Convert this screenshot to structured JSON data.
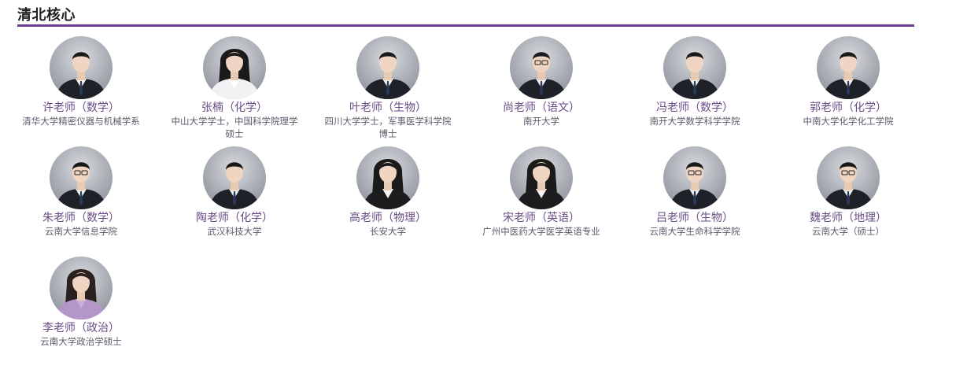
{
  "section": {
    "title": "清北核心"
  },
  "teachers": [
    {
      "name": "许老师（数学）",
      "school": "清华大学精密仪器与机械学系",
      "avatar": "male-suit-teacher"
    },
    {
      "name": "张楠（化学）",
      "school": "中山大学学士，中国科学院理学硕士",
      "avatar": "female-white-blouse-teacher"
    },
    {
      "name": "叶老师（生物）",
      "school": "四川大学学士，军事医学科学院博士",
      "avatar": "male-dark-suit-teacher"
    },
    {
      "name": "尚老师（语文）",
      "school": "南开大学",
      "avatar": "male-glasses-teacher"
    },
    {
      "name": "冯老师（数学）",
      "school": "南开大学数学科学学院",
      "avatar": "male-suit-teacher"
    },
    {
      "name": "郭老师（化学）",
      "school": "中南大学化学化工学院",
      "avatar": "male-suit-teacher"
    },
    {
      "name": "朱老师（数学）",
      "school": "云南大学信息学院",
      "avatar": "male-glasses-teacher"
    },
    {
      "name": "陶老师（化学）",
      "school": "武汉科技大学",
      "avatar": "male-suit-teacher"
    },
    {
      "name": "高老师（物理）",
      "school": "长安大学",
      "avatar": "female-long-hair-teacher"
    },
    {
      "name": "宋老师（英语）",
      "school": "广州中医药大学医学英语专业",
      "avatar": "female-long-hair-teacher"
    },
    {
      "name": "吕老师（生物）",
      "school": "云南大学生命科学学院",
      "avatar": "male-glasses-teacher"
    },
    {
      "name": "魏老师（地理）",
      "school": "云南大学（硕士）",
      "avatar": "male-glasses-teacher"
    },
    {
      "name": "李老师（政治）",
      "school": "云南大学政治学硕士",
      "avatar": "female-purple-sweater-teacher"
    }
  ],
  "colors": {
    "accent": "#6a3e94",
    "name_text": "#6a4d87",
    "school_text": "#5b5b6b"
  }
}
